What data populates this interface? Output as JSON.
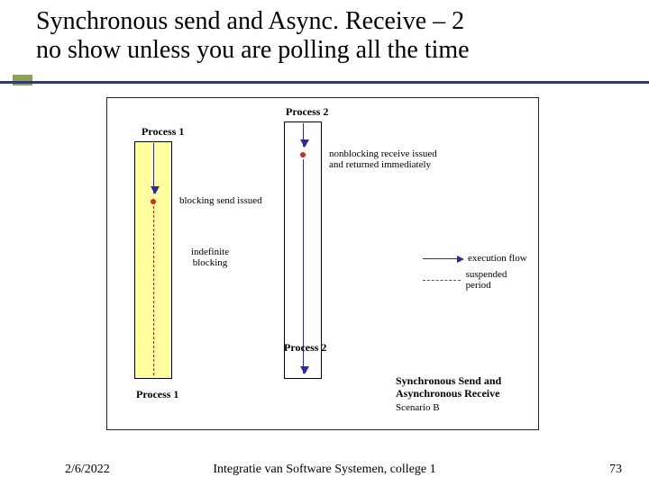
{
  "title_line1": "Synchronous send and Async. Receive – 2",
  "title_line2": "no show unless you are polling all the time",
  "figure": {
    "process1_top": "Process 1",
    "process2_top": "Process 2",
    "process1_bottom": "Process 1",
    "process2_bottom": "Process 2",
    "blocking_send": "blocking send issued",
    "indefinite_blocking_line1": "indefinite",
    "indefinite_blocking_line2": "blocking",
    "nonblocking_recv_line1": "nonblocking receive issued",
    "nonblocking_recv_line2": "and returned immediately",
    "legend_exec": "execution flow",
    "legend_susp": "suspended period",
    "caption_bold_line1": "Synchronous Send and",
    "caption_bold_line2": "Asynchronous Receive",
    "caption_scenario": "Scenario B"
  },
  "footer": {
    "date": "2/6/2022",
    "center": "Integratie van Software Systemen, college 1",
    "page": "73"
  }
}
